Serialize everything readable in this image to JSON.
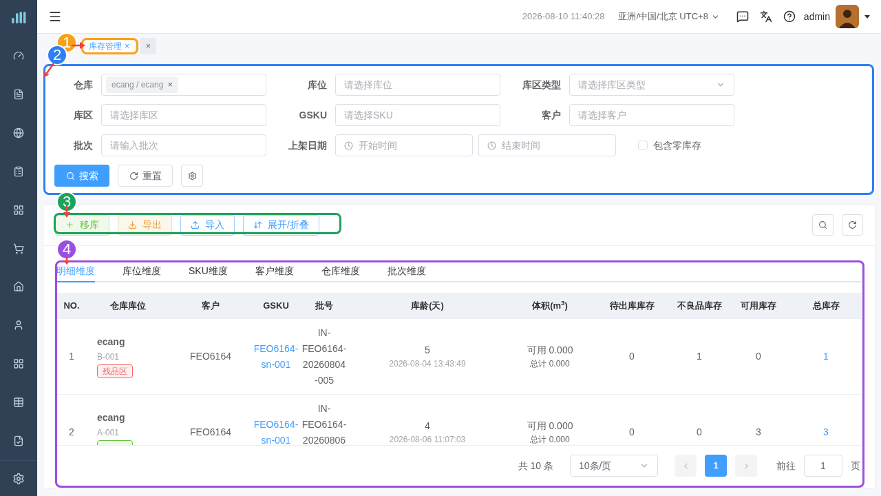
{
  "header": {
    "datetime": "2026-08-10 11:40:28",
    "timezone": "亚洲/中国/北京 UTC+8",
    "user": "admin"
  },
  "tabs": [
    {
      "label": "库存管理",
      "selected": true,
      "close": "×"
    },
    {
      "selected": false,
      "close": "×"
    }
  ],
  "filters": [
    {
      "label": "仓库",
      "kind": "tag",
      "value": "ecang / ecang",
      "close": "×"
    },
    {
      "label": "库位",
      "kind": "input",
      "placeholder": "请选择库位"
    },
    {
      "label": "库区类型",
      "kind": "select",
      "placeholder": "请选择库区类型"
    },
    {
      "label": "库区",
      "kind": "input",
      "placeholder": "请选择库区"
    },
    {
      "label": "GSKU",
      "kind": "input",
      "placeholder": "请选择SKU"
    },
    {
      "label": "客户",
      "kind": "input",
      "placeholder": "请选择客户"
    },
    {
      "label": "批次",
      "kind": "input",
      "placeholder": "请输入批次"
    },
    {
      "label": "上架日期",
      "kind": "daterange",
      "start": "开始时间",
      "end": "结束时间"
    },
    {
      "label": "包含零库存",
      "kind": "checkbox",
      "checked": false
    }
  ],
  "form_buttons": [
    {
      "label": "搜索",
      "kind": "primary"
    },
    {
      "label": "重置",
      "kind": "default"
    },
    {
      "kind": "settings"
    }
  ],
  "toolbar": [
    {
      "label": "移库",
      "kind": "success"
    },
    {
      "label": "导出",
      "kind": "warning"
    },
    {
      "label": "导入",
      "kind": "info"
    },
    {
      "label": "展开/折叠",
      "kind": "info"
    }
  ],
  "view_tabs": [
    {
      "label": "明细维度",
      "selected": true
    },
    {
      "label": "库位维度",
      "selected": false
    },
    {
      "label": "SKU维度",
      "selected": false
    },
    {
      "label": "客户维度",
      "selected": false
    },
    {
      "label": "仓库维度",
      "selected": false
    },
    {
      "label": "批次维度",
      "selected": false
    }
  ],
  "table": {
    "columns": [
      "NO.",
      "仓库库位",
      "客户",
      "GSKU",
      "批号",
      "库龄(天)",
      "体积(m$^{3}$)",
      "待出库库存",
      "不良品库存",
      "可用库存",
      "总库存"
    ],
    "rows": [
      {
        "no": "1",
        "warehouse": "ecang",
        "location": "B-001",
        "tag": {
          "text": "残品区",
          "color": "#f56c6c"
        },
        "customer": "FEO6164",
        "gsku": [
          "FEO6164-",
          "sn-001"
        ],
        "batch": [
          "IN-",
          "FEO6164-",
          "20260804",
          "-005"
        ],
        "age": "5",
        "age_time": "2026-08-04 13:43:49",
        "volume_available": "可用 0.000",
        "volume_total": "总计 0.000",
        "pending": "0",
        "defective": "1",
        "available": "0",
        "total": "1"
      },
      {
        "no": "2",
        "warehouse": "ecang",
        "location": "A-001",
        "tag": {
          "color": "#67c23a"
        },
        "customer": "FEO6164",
        "gsku": [
          "FEO6164-",
          "sn-001"
        ],
        "batch": [
          "IN-",
          "FEO6164-",
          "20260806"
        ],
        "age": "4",
        "age_time": "2026-08-06 11:07:03",
        "volume_available": "可用 0.000",
        "volume_total": "总计 0.000",
        "pending": "0",
        "defective": "0",
        "available": "3",
        "total": "3"
      }
    ]
  },
  "pagination": {
    "total": "共 10 条",
    "page_size": "10条/页",
    "pages": [
      {
        "label": "1",
        "selected": true
      }
    ],
    "goto_label": "前往",
    "goto_value": "1",
    "goto_suffix": "页"
  },
  "annotations": [
    {
      "number": "1",
      "color": "#f7a11a"
    },
    {
      "number": "2",
      "color": "#2f7ff5"
    },
    {
      "number": "3",
      "color": "#1aa35a"
    },
    {
      "number": "4",
      "color": "#9b4fe0"
    }
  ]
}
